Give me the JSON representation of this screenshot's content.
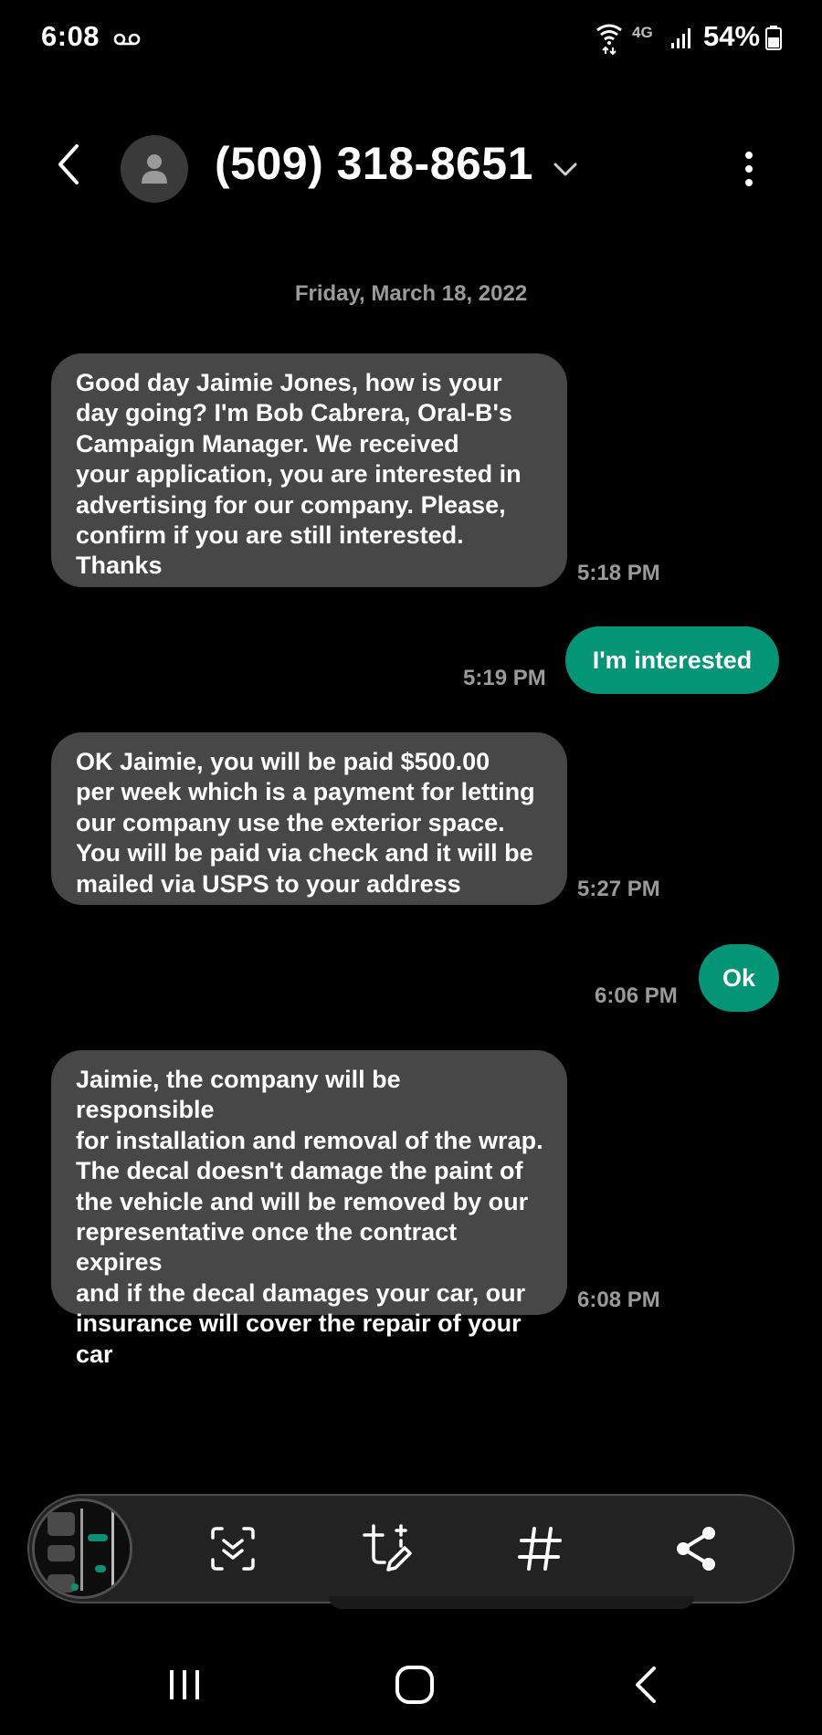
{
  "status_bar": {
    "time": "6:08",
    "network": "4G",
    "battery": "54%",
    "icons": [
      "voicemail-icon",
      "wifi-icon",
      "signal-icon",
      "battery-icon"
    ]
  },
  "header": {
    "contact": "(509) 318-8651",
    "icons": [
      "back-arrow-icon",
      "avatar-person-icon",
      "chevron-down-icon",
      "more-options-icon"
    ]
  },
  "conversation": {
    "date": "Friday, March 18, 2022",
    "messages": [
      {
        "direction": "incoming",
        "text": "Good day Jaimie Jones, how is your\nday going? I'm Bob Cabrera, Oral-B's\nCampaign Manager. We received\nyour application, you are interested in\nadvertising for our company. Please,\nconfirm if you are still interested.\nThanks",
        "time": "5:18 PM"
      },
      {
        "direction": "outgoing",
        "text": "I'm interested",
        "time": "5:19 PM"
      },
      {
        "direction": "incoming",
        "text": "OK Jaimie, you will be paid $500.00\nper week which is a payment for letting\nour company use the exterior space.\nYou will be paid via check and it will be\nmailed via USPS to your address",
        "time": "5:27 PM"
      },
      {
        "direction": "outgoing",
        "text": "Ok",
        "time": "6:06 PM"
      },
      {
        "direction": "incoming",
        "text": "Jaimie, the company will be responsible\nfor installation and removal of the wrap.\nThe decal doesn't damage the paint of\nthe vehicle and will be removed by our\nrepresentative once the contract expires\nand if the decal damages your car, our\ninsurance will cover the repair of your\ncar",
        "time": "6:08 PM"
      }
    ]
  },
  "toolbar": {
    "icons": [
      "screenshot-thumbnail",
      "scroll-capture-icon",
      "draw-crop-icon",
      "hashtag-icon",
      "share-icon"
    ]
  },
  "navbar": {
    "icons": [
      "recents-icon",
      "home-icon",
      "back-icon"
    ]
  },
  "colors": {
    "background": "#000000",
    "incoming_bubble": "#474747",
    "outgoing_bubble": "#049476",
    "timestamp": "#9a9a9a"
  }
}
